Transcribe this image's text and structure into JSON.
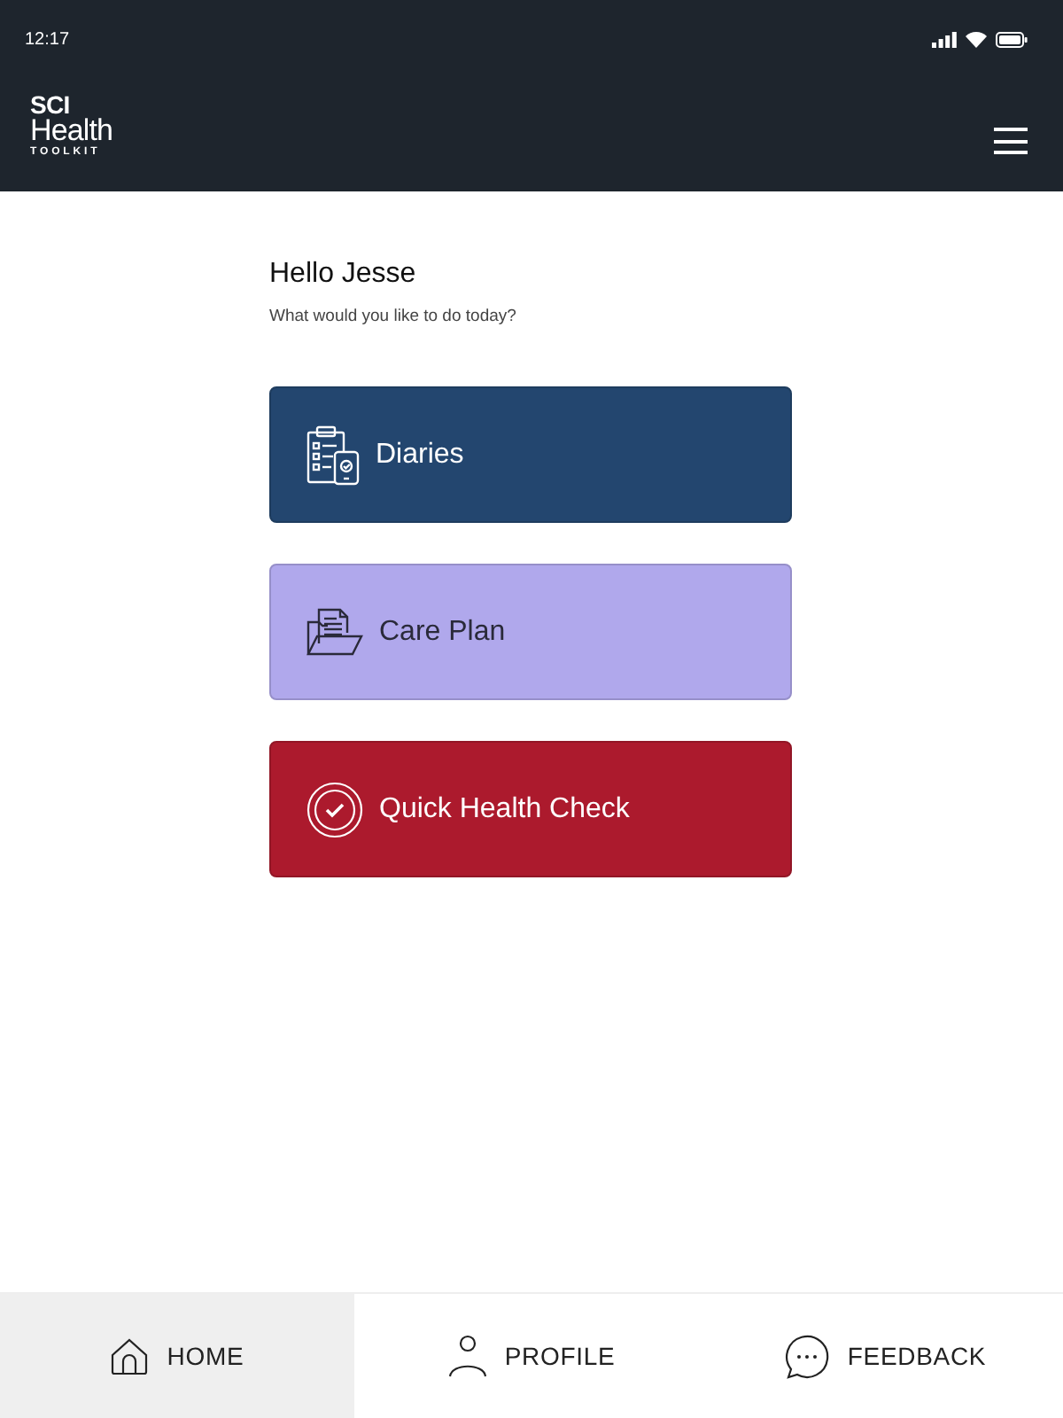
{
  "status_bar": {
    "time": "12:17"
  },
  "header": {
    "logo": {
      "line_1": "SCI",
      "line_2": "Health",
      "line_3": "TOOLKIT"
    }
  },
  "greeting": {
    "title": "Hello Jesse",
    "subtitle": "What would you like to do today?"
  },
  "actions": [
    {
      "kind": "diaries",
      "label": "Diaries",
      "color": "#23466f"
    },
    {
      "kind": "care_plan",
      "label": "Care Plan",
      "color": "#b0a8ec"
    },
    {
      "kind": "health_check",
      "label": "Quick Health Check",
      "color": "#ac1a2d"
    }
  ],
  "bottom_nav": [
    {
      "kind": "home",
      "label": "HOME",
      "selected": true
    },
    {
      "kind": "profile",
      "label": "PROFILE",
      "selected": false
    },
    {
      "kind": "feedback",
      "label": "FEEDBACK",
      "selected": false
    }
  ]
}
